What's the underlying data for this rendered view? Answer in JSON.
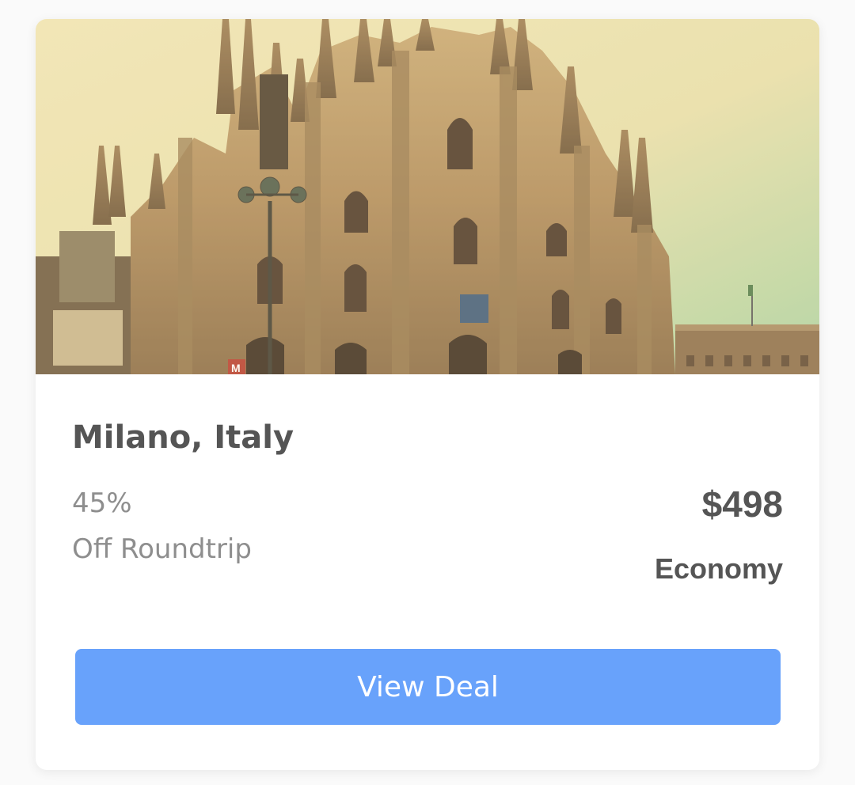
{
  "card": {
    "image_alt": "Milan Cathedral",
    "destination": "Milano, Italy",
    "discount_percent": "45%",
    "discount_label": "Off Roundtrip",
    "price": "$498",
    "cabin_class": "Economy",
    "cta_label": "View Deal"
  },
  "colors": {
    "button": "#68a2fb",
    "title": "#555555",
    "muted": "#8e8e8e"
  }
}
